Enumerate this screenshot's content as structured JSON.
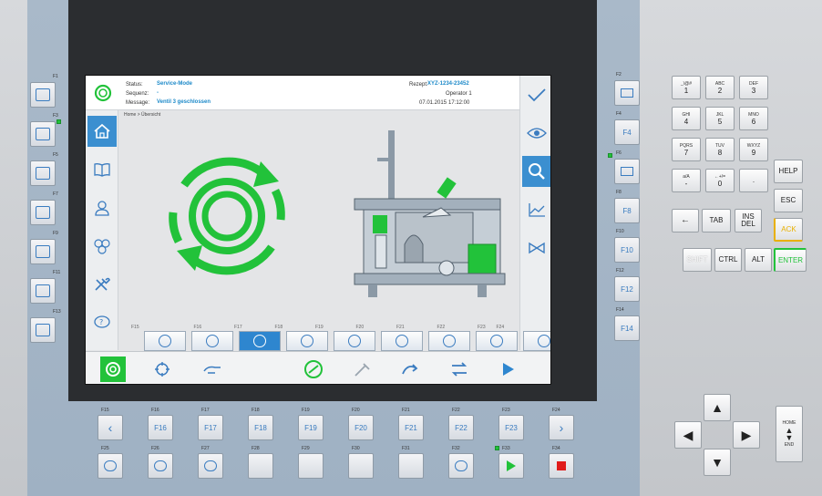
{
  "header": {
    "status_label": "Status:",
    "status_value": "Service-Mode",
    "sequence_label": "Sequenz:",
    "sequence_value": "-",
    "message_label": "Message:",
    "message_value": "Ventil 3 geschlossen",
    "recipe_label": "Rezept:",
    "recipe_value": "XYZ-1234-23452",
    "operator": "Operator 1",
    "date": "07.01.2015",
    "time": "17:12:00"
  },
  "breadcrumb": "Home > Übersicht",
  "screen_fkeys": [
    "F15",
    "F16",
    "F17",
    "F18",
    "F19",
    "F20",
    "F21",
    "F22",
    "F23",
    "F24"
  ],
  "left_keys": [
    "F1",
    "F3",
    "F5",
    "F7",
    "F9",
    "F11",
    "F13"
  ],
  "right_keys": [
    "F2",
    "F4",
    "F6",
    "F8",
    "F10",
    "F12",
    "F14"
  ],
  "right_key_labels": [
    "",
    "F4",
    "",
    "F8",
    "F10",
    "F12",
    "F14"
  ],
  "bottom_row1": [
    "F15",
    "F16",
    "F17",
    "F18",
    "F19",
    "F20",
    "F21",
    "F22",
    "F23",
    "F24"
  ],
  "bottom_row1_labels": [
    "",
    "F16",
    "F17",
    "F18",
    "F19",
    "F20",
    "F21",
    "F22",
    "F23",
    ""
  ],
  "bottom_row2": [
    "F25",
    "F26",
    "F27",
    "F28",
    "F29",
    "F30",
    "F31",
    "F32",
    "F33",
    "F34"
  ],
  "numpad": [
    {
      "top": "_\\@#",
      "main": "1"
    },
    {
      "top": "ABC",
      "main": "2"
    },
    {
      "top": "DEF",
      "main": "3"
    },
    {
      "top": "GHI",
      "main": "4"
    },
    {
      "top": "JKL",
      "main": "5"
    },
    {
      "top": "MNO",
      "main": "6"
    },
    {
      "top": "PQRS",
      "main": "7"
    },
    {
      "top": "TUV",
      "main": "8"
    },
    {
      "top": "WXYZ",
      "main": "9"
    },
    {
      "top": "a/A",
      "main": "-"
    },
    {
      "top": "←+/=",
      "main": "0"
    },
    {
      "top": "",
      "main": "."
    }
  ],
  "special_keys": {
    "help": "HELP",
    "esc": "ESC",
    "ack": "ACK",
    "tab": "TAB",
    "ins": "INS",
    "del": "DEL",
    "shift": "SHIFT",
    "ctrl": "CTRL",
    "alt": "ALT",
    "enter": "ENTER",
    "home": "HOME",
    "end": "END"
  },
  "colors": {
    "accent_blue": "#3b8fd0",
    "green": "#22c23a",
    "stop_red": "#e01b1b",
    "ack_yellow": "#e8b000"
  }
}
